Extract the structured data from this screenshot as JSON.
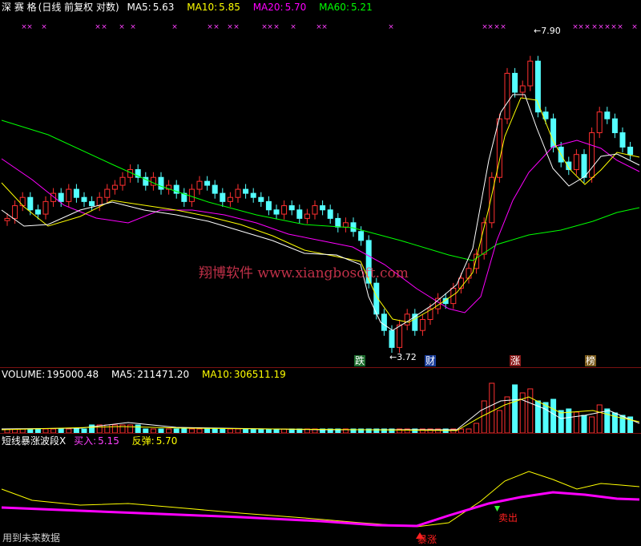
{
  "colors": {
    "up": "#ff3030",
    "down": "#54ffff",
    "ma5": "#ffffff",
    "ma10": "#ffff00",
    "ma20": "#ff00ff",
    "ma60": "#00ff00",
    "separator": "#7a1010",
    "marker": "#ff40ff",
    "watermark": "#ff4060"
  },
  "price_header": {
    "stock_name": "深 赛 格",
    "period": "(日线 前复权 对数)",
    "ma5_label": "MA5:",
    "ma5_value": "5.63",
    "ma10_label": "MA10:",
    "ma10_value": "5.85",
    "ma20_label": "MA20:",
    "ma20_value": "5.70",
    "ma60_label": "MA60:",
    "ma60_value": "5.21"
  },
  "price_panel": {
    "high_label": "7.90",
    "low_label": "3.72",
    "watermark": "翔博软件 www.xiangbosoft.com",
    "event_tags": [
      "跌",
      "财",
      "涨",
      "榜"
    ]
  },
  "volume_header": {
    "title": "VOLUME:",
    "value": "195000.48",
    "ma5_label": "MA5:",
    "ma5_value": "211471.20",
    "ma10_label": "MA10:",
    "ma10_value": "306511.19"
  },
  "indicator_header": {
    "title": "短线暴涨波段X",
    "buy_label": "买入:",
    "buy_value": "5.15",
    "rebound_label": "反弹:",
    "rebound_value": "5.70"
  },
  "indicator_panel": {
    "surge_signal": "暴涨",
    "sell_signal": "卖出"
  },
  "footer": {
    "note": "用到未来数据"
  },
  "chart_data": [
    {
      "type": "candlestick",
      "title": "深 赛 格",
      "x_sample_step": 2,
      "close_trace_approx": [
        5.1,
        5.25,
        5.35,
        5.2,
        5.15,
        5.3,
        5.4,
        5.3,
        5.45,
        5.35,
        5.3,
        5.25,
        5.35,
        5.45,
        5.5,
        5.6,
        5.7,
        5.6,
        5.5,
        5.6,
        5.45,
        5.5,
        5.4,
        5.3,
        5.45,
        5.55,
        5.5,
        5.4,
        5.3,
        5.35,
        5.45,
        5.4,
        5.35,
        5.3,
        5.2,
        5.15,
        5.25,
        5.2,
        5.1,
        5.15,
        5.25,
        5.2,
        5.1,
        5.0,
        5.05,
        4.95,
        4.85,
        4.4,
        4.1,
        3.95,
        3.8,
        4.0,
        4.1,
        3.95,
        4.05,
        4.15,
        4.25,
        4.2,
        4.35,
        4.45,
        4.55,
        4.7,
        5.05,
        5.6,
        6.4,
        7.1,
        6.8,
        6.9,
        7.3,
        6.5,
        6.4,
        6.0,
        5.8,
        5.7,
        5.9,
        5.6,
        6.2,
        6.5,
        6.4,
        6.2,
        6.0,
        5.9
      ],
      "high": 7.9,
      "low": 3.72,
      "ma_last": {
        "MA5": 5.63,
        "MA10": 5.85,
        "MA20": 5.7,
        "MA60": 5.21
      }
    },
    {
      "type": "bar",
      "title": "VOLUME",
      "last": 195000.48,
      "ma_last": {
        "MA5": 211471.2,
        "MA10": 306511.19
      }
    },
    {
      "type": "line",
      "title": "短线暴涨波段X",
      "series": [
        {
          "name": "买入",
          "last": 5.15
        },
        {
          "name": "反弹",
          "last": 5.7
        }
      ]
    }
  ]
}
